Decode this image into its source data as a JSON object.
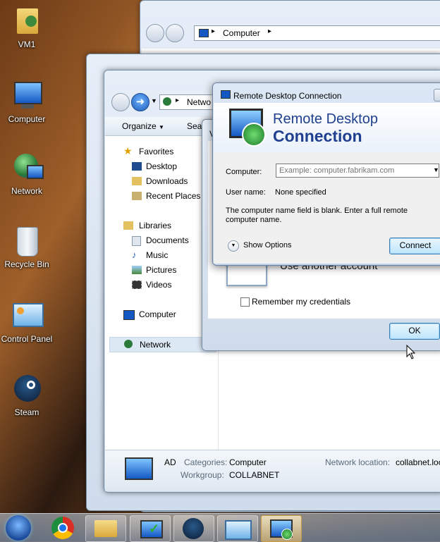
{
  "desktop": {
    "icons": [
      {
        "label": "VM1",
        "icon": "user-folder-icon"
      },
      {
        "label": "Computer",
        "icon": "computer-icon"
      },
      {
        "label": "Network",
        "icon": "network-globe-icon"
      },
      {
        "label": "Recycle Bin",
        "icon": "recycle-bin-icon"
      },
      {
        "label": "Control Panel",
        "icon": "control-panel-icon"
      },
      {
        "label": "Steam",
        "icon": "steam-icon"
      }
    ]
  },
  "back_window": {
    "address": "Computer"
  },
  "explorer": {
    "address": "Netwo",
    "toolbar": {
      "organize": "Organize",
      "search_partial": "Sear"
    },
    "nav": {
      "favorites": "Favorites",
      "desktop": "Desktop",
      "downloads": "Downloads",
      "recent": "Recent Places",
      "libraries": "Libraries",
      "documents": "Documents",
      "music": "Music",
      "pictures": "Pictures",
      "videos": "Videos",
      "computer": "Computer",
      "network": "Network"
    },
    "details": {
      "name": "AD",
      "categories_label": "Categories:",
      "categories_value": "Computer",
      "workgroup_label": "Workgroup:",
      "workgroup_value": "COLLABNET",
      "location_label": "Network location:",
      "location_value": "collabnet.loc"
    }
  },
  "credential_dialog": {
    "partial_letter": "V",
    "use_another": "Use another account",
    "remember": "Remember my credentials",
    "ok": "OK"
  },
  "rdc": {
    "title": "Remote Desktop Connection",
    "header_line1": "Remote Desktop",
    "header_line2": "Connection",
    "computer_label": "Computer:",
    "computer_placeholder": "Example: computer.fabrikam.com",
    "username_label": "User name:",
    "username_value": "None specified",
    "message": "The computer name field is blank. Enter a full remote computer name.",
    "show_options": "Show Options",
    "connect": "Connect"
  },
  "taskbar": {
    "items": [
      "start-orb",
      "chrome-icon",
      "explorer-icon",
      "vm-icon",
      "steam-icon",
      "control-panel-icon",
      "rdc-icon"
    ]
  },
  "colors": {
    "header_blue": "#1f3f8f",
    "accent": "#1d5fb8"
  }
}
